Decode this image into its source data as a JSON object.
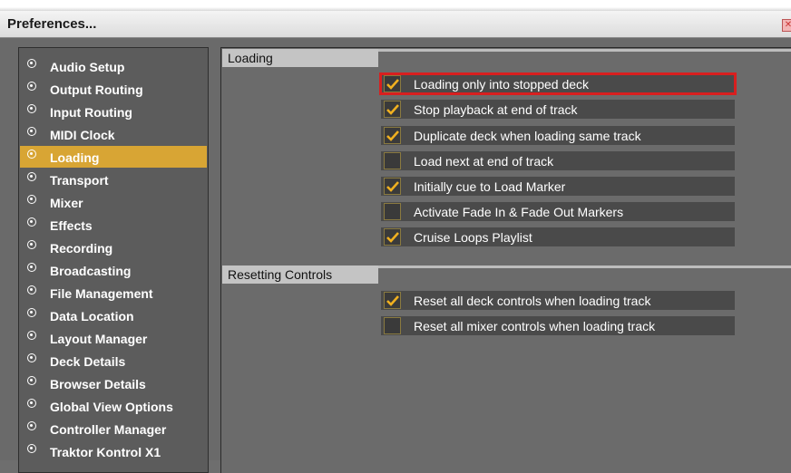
{
  "window": {
    "title": "Preferences..."
  },
  "colors": {
    "accent": "#d8a534",
    "highlight_border": "#d81f1f",
    "check": "#f0b020"
  },
  "sidebar": {
    "items": [
      {
        "label": "Audio Setup",
        "active": false
      },
      {
        "label": "Output Routing",
        "active": false
      },
      {
        "label": "Input Routing",
        "active": false
      },
      {
        "label": "MIDI Clock",
        "active": false
      },
      {
        "label": "Loading",
        "active": true
      },
      {
        "label": "Transport",
        "active": false
      },
      {
        "label": "Mixer",
        "active": false
      },
      {
        "label": "Effects",
        "active": false
      },
      {
        "label": "Recording",
        "active": false
      },
      {
        "label": "Broadcasting",
        "active": false
      },
      {
        "label": "File Management",
        "active": false
      },
      {
        "label": "Data Location",
        "active": false
      },
      {
        "label": "Layout Manager",
        "active": false
      },
      {
        "label": "Deck Details",
        "active": false
      },
      {
        "label": "Browser Details",
        "active": false
      },
      {
        "label": "Global View Options",
        "active": false
      },
      {
        "label": "Controller Manager",
        "active": false
      },
      {
        "label": "Traktor Kontrol X1",
        "active": false
      }
    ]
  },
  "sections": {
    "loading": {
      "title": "Loading",
      "options": [
        {
          "label": "Loading only into stopped deck",
          "checked": true,
          "highlighted": true
        },
        {
          "label": "Stop playback at end of track",
          "checked": true,
          "highlighted": false
        },
        {
          "label": "Duplicate deck when loading same track",
          "checked": true,
          "highlighted": false
        },
        {
          "label": "Load next at end of track",
          "checked": false,
          "highlighted": false
        },
        {
          "label": "Initially cue to Load Marker",
          "checked": true,
          "highlighted": false
        },
        {
          "label": "Activate Fade In & Fade Out Markers",
          "checked": false,
          "highlighted": false
        },
        {
          "label": "Cruise Loops Playlist",
          "checked": true,
          "highlighted": false
        }
      ]
    },
    "resetting": {
      "title": "Resetting Controls",
      "options": [
        {
          "label": "Reset all deck controls when loading track",
          "checked": true,
          "highlighted": false
        },
        {
          "label": "Reset all mixer controls when loading track",
          "checked": false,
          "highlighted": false
        }
      ]
    }
  }
}
